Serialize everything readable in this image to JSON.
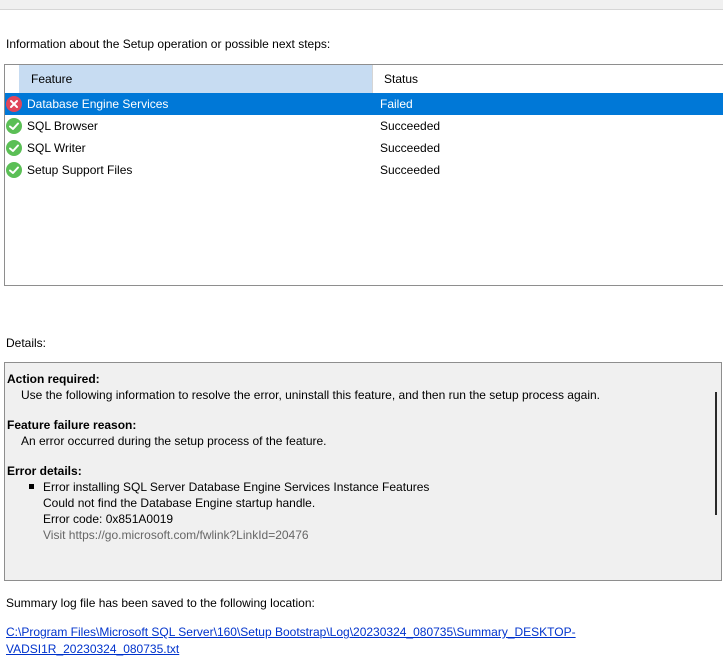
{
  "info_label": "Information about the Setup operation or possible next steps:",
  "grid": {
    "columns": {
      "feature": "Feature",
      "status": "Status"
    },
    "rows": [
      {
        "feature": "Database Engine Services",
        "status": "Failed",
        "icon": "error-icon",
        "selected": true
      },
      {
        "feature": "SQL Browser",
        "status": "Succeeded",
        "icon": "success-icon",
        "selected": false
      },
      {
        "feature": "SQL Writer",
        "status": "Succeeded",
        "icon": "success-icon",
        "selected": false
      },
      {
        "feature": "Setup Support Files",
        "status": "Succeeded",
        "icon": "success-icon",
        "selected": false
      }
    ]
  },
  "details_label": "Details:",
  "details": {
    "action_title": "Action required:",
    "action_body": "Use the following information to resolve the error, uninstall this feature, and then run the setup process again.",
    "reason_title": "Feature failure reason:",
    "reason_body": "An error occurred during the setup process of the feature.",
    "error_title": "Error details:",
    "error_line1": "Error installing SQL Server Database Engine Services Instance Features",
    "error_line2": "Could not find the Database Engine startup handle.",
    "error_line3": "Error code: 0x851A0019",
    "error_line4": "Visit https://go.microsoft.com/fwlink?LinkId=20476"
  },
  "summary_label": "Summary log file has been saved to the following location:",
  "summary_link": "C:\\Program Files\\Microsoft SQL Server\\160\\Setup Bootstrap\\Log\\20230324_080735\\Summary_DESKTOP-VADSI1R_20230324_080735.txt",
  "colors": {
    "selection": "#0078d7",
    "header_highlight": "#c7dcf2",
    "error": "#e0455a",
    "success": "#5bbf56",
    "link": "#0033cc"
  }
}
